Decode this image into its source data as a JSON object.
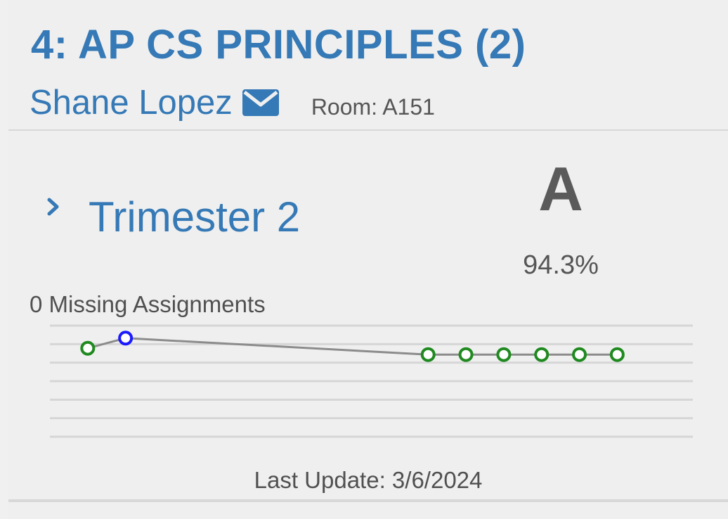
{
  "course": {
    "title": "4: AP CS PRINCIPLES (2)",
    "teacher": "Shane Lopez",
    "room": "Room: A151"
  },
  "term": {
    "label": "Trimester 2",
    "grade_letter": "A",
    "grade_percent": "94.3%",
    "missing": "0 Missing Assignments",
    "last_update": "Last Update: 3/6/2024"
  },
  "colors": {
    "accent": "#3579b6",
    "point_default": "#1f8a1f",
    "point_highlight": "#1a1aff",
    "trend_line": "#8c8c8c"
  },
  "icons": {
    "mail": "envelope-icon",
    "expand": "chevron-right-icon"
  },
  "chart_data": {
    "type": "line",
    "title": "",
    "xlabel": "",
    "ylabel": "",
    "grid": true,
    "series": [
      {
        "points": [
          {
            "x": 1,
            "y": 95.8
          },
          {
            "x": 2,
            "y": 98.2
          },
          {
            "x": 10,
            "y": 94.3
          },
          {
            "x": 11,
            "y": 94.3
          },
          {
            "x": 12,
            "y": 94.3
          },
          {
            "x": 13,
            "y": 94.3
          },
          {
            "x": 14,
            "y": 94.3
          },
          {
            "x": 15,
            "y": 94.3
          }
        ],
        "highlight_index": 1
      }
    ]
  }
}
